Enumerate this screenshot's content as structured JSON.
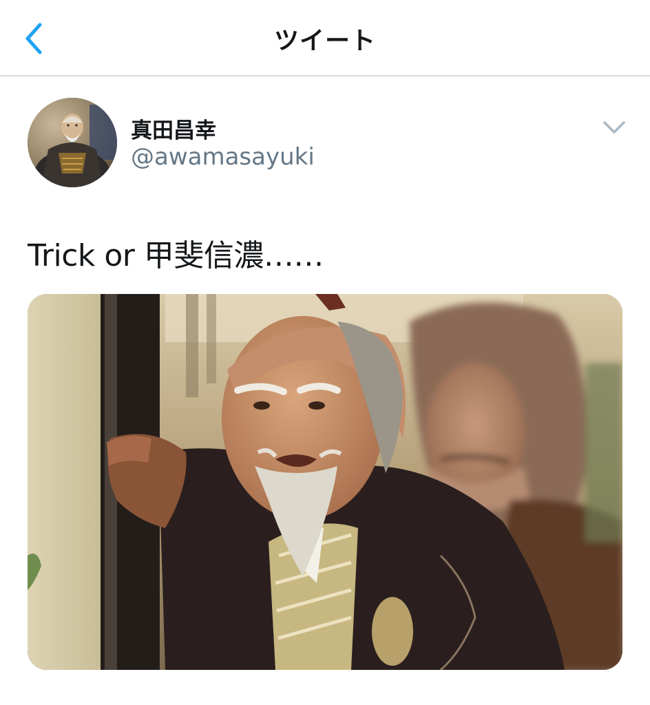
{
  "navbar": {
    "title": "ツイート",
    "back_icon": "chevron-left-icon"
  },
  "tweet": {
    "display_name": "真田昌幸",
    "handle": "@awamasayuki",
    "text": "Trick or 甲斐信濃……",
    "menu_icon": "chevron-down-icon"
  },
  "colors": {
    "accent": "#1da1f2",
    "text": "#14171a",
    "secondary": "#657786",
    "divider": "#d4dbe0"
  }
}
